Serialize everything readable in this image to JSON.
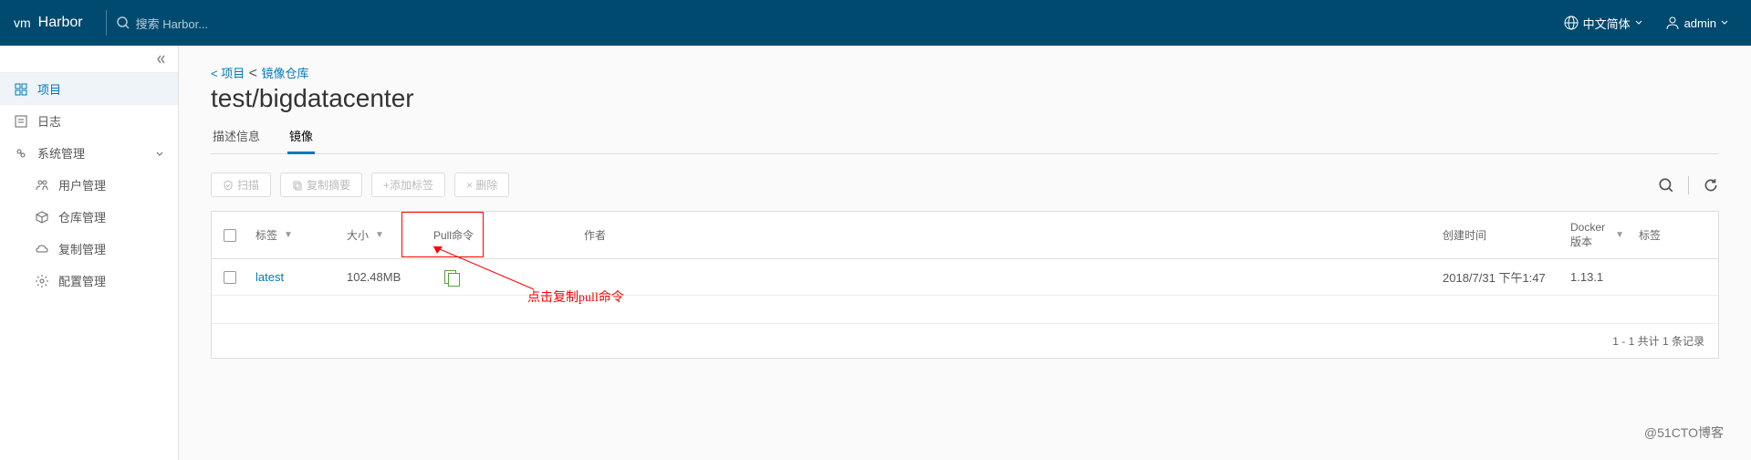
{
  "header": {
    "logo_prefix": "vm",
    "logo_name": "Harbor",
    "search_placeholder": "搜索 Harbor...",
    "language": "中文简体",
    "user": "admin"
  },
  "sidebar": {
    "items": [
      {
        "name": "projects",
        "label": "项目",
        "active": true
      },
      {
        "name": "logs",
        "label": "日志"
      },
      {
        "name": "system",
        "label": "系统管理",
        "expandable": true
      },
      {
        "name": "users",
        "label": "用户管理",
        "sub": true
      },
      {
        "name": "repos",
        "label": "仓库管理",
        "sub": true
      },
      {
        "name": "replication",
        "label": "复制管理",
        "sub": true
      },
      {
        "name": "config",
        "label": "配置管理",
        "sub": true
      }
    ]
  },
  "breadcrumb": {
    "back": "< 项目",
    "current": "镜像仓库",
    "prefix": "< "
  },
  "page_title": "test/bigdatacenter",
  "tabs": [
    {
      "name": "info",
      "label": "描述信息"
    },
    {
      "name": "images",
      "label": "镜像",
      "active": true
    }
  ],
  "toolbar": {
    "scan": "扫描",
    "copy_summary": "复制摘要",
    "add_label": "+添加标签",
    "delete": "× 删除"
  },
  "grid": {
    "columns": {
      "tag": "标签",
      "size": "大小",
      "pull": "Pull命令",
      "author": "作者",
      "created": "创建时间",
      "docker": "Docker版本",
      "labels": "标签"
    },
    "rows": [
      {
        "tag": "latest",
        "size": "102.48MB",
        "created": "2018/7/31 下午1:47",
        "docker": "1.13.1"
      }
    ],
    "footer": "1 - 1 共计 1 条记录"
  },
  "annotation": "点击复制pull命令",
  "watermark": "@51CTO博客"
}
